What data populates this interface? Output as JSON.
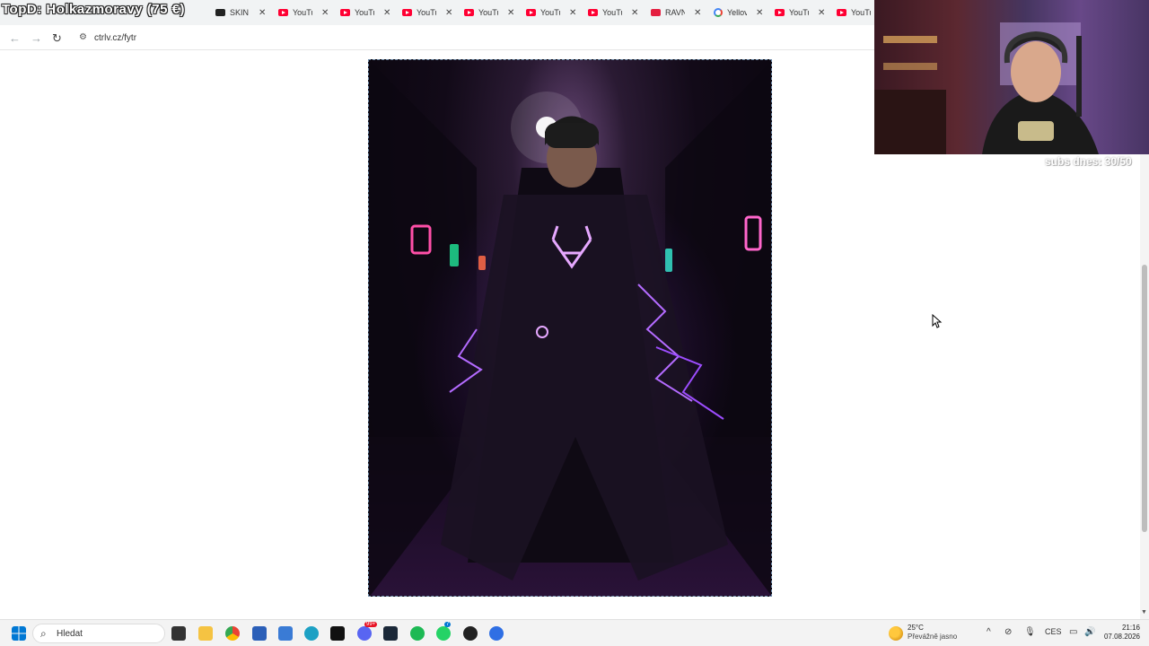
{
  "overlay": {
    "title": "TopD: Holkazmoravy (75 €)",
    "subs": "subs dnes: 30/50"
  },
  "tabs": [
    {
      "label": "SKIN",
      "icon": "skinport-icon"
    },
    {
      "label": "YouTu",
      "icon": "youtube-icon"
    },
    {
      "label": "YouTu",
      "icon": "youtube-icon"
    },
    {
      "label": "YouTu",
      "icon": "youtube-icon"
    },
    {
      "label": "YouTu",
      "icon": "youtube-icon"
    },
    {
      "label": "YouTu",
      "icon": "youtube-icon"
    },
    {
      "label": "YouTu",
      "icon": "youtube-icon"
    },
    {
      "label": "RAVN",
      "icon": "ravn-icon"
    },
    {
      "label": "Yellov",
      "icon": "google-icon"
    },
    {
      "label": "YouTu",
      "icon": "youtube-icon"
    },
    {
      "label": "YouTu",
      "icon": "youtube-icon"
    }
  ],
  "toolbar": {
    "url": "ctrlv.cz/fytr"
  },
  "taskbar": {
    "search_label": "Hledat",
    "weather_temp": "25°C",
    "weather_desc": "Převážně jasno",
    "language": "CES",
    "time": "21:16",
    "date": "07.08.2026",
    "notification_badge": "99+",
    "whatsapp_badge": "7"
  },
  "colors": {
    "accent_purple": "#9b4dff",
    "youtube_red": "#ff0033",
    "taskbar_bg": "#f3f3f3"
  }
}
